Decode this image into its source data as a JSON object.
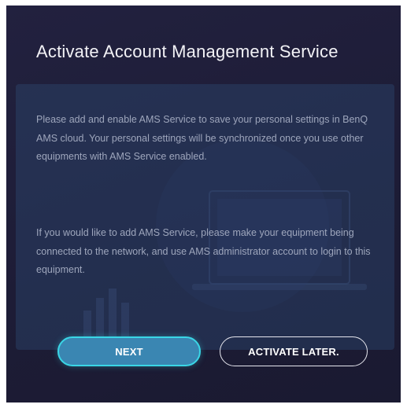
{
  "dialog": {
    "title": "Activate Account Management Service",
    "paragraphs": [
      "Please add and enable AMS Service to save your personal settings in BenQ AMS cloud. Your personal settings will be synchronized once you use other equipments with AMS Service enabled.",
      "If you would like to add AMS Service, please make your equipment being connected to the network, and use AMS administrator account to login to this equipment."
    ],
    "buttons": {
      "next_label": "NEXT",
      "later_label": "ACTIVATE LATER."
    }
  },
  "colors": {
    "background": "#1d1c36",
    "panel": "#2d4b73",
    "accent": "#3ad6e6",
    "primary_button": "#3a86b2",
    "body_text": "#9ea6bc"
  }
}
